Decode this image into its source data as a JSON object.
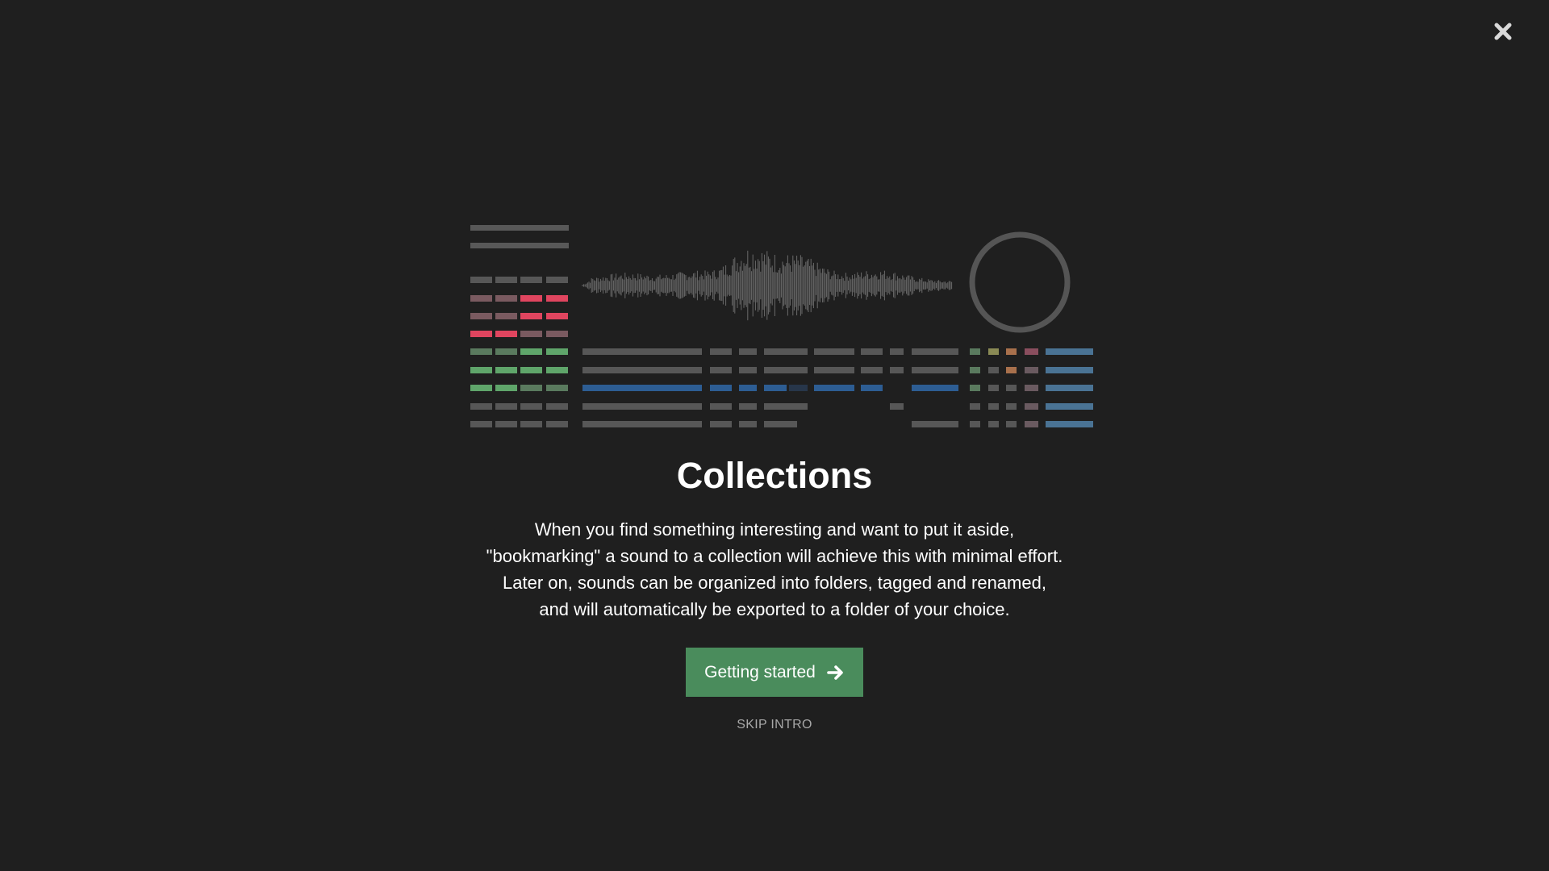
{
  "modal": {
    "close_icon": "close-icon",
    "illustration_icon": "collections-illustration",
    "title": "Collections",
    "description_lines": [
      "When you find something interesting and want to put it aside,",
      "\"bookmarking\" a sound to a collection will achieve this with minimal effort.",
      "Later on, sounds can be organized into folders, tagged and renamed,",
      "and will automatically be exported to a folder of your choice."
    ],
    "primary_button_label": "Getting started",
    "primary_button_icon": "arrow-right-icon",
    "skip_label": "SKIP INTRO"
  },
  "colors": {
    "background": "#1f1f1f",
    "primary_button": "#4a8c5c",
    "bar_gray": "#5a5a5a",
    "bar_red": "#e0455f",
    "bar_green": "#5fa56a",
    "bar_blue": "#2d5d93",
    "bar_steel_blue": "#4a7394"
  }
}
